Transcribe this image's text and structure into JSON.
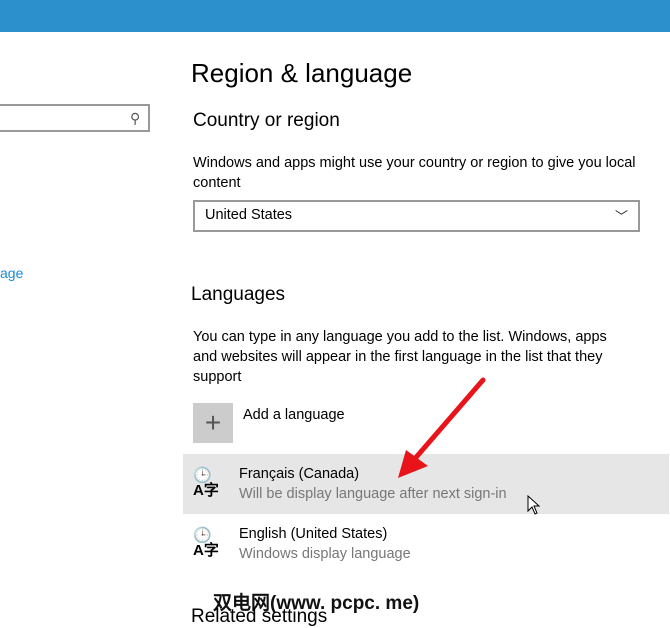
{
  "sidebar": {
    "search_placeholder": "",
    "link_fragment": "age"
  },
  "header": {
    "title": "Region & language"
  },
  "country": {
    "heading": "Country or region",
    "description": "Windows and apps might use your country or region to give you local content",
    "selected": "United States"
  },
  "languages": {
    "heading": "Languages",
    "description": "You can type in any language you add to the list. Windows, apps and websites will appear in the first language in the list that they support",
    "add_label": "Add a language",
    "items": [
      {
        "name": "Français (Canada)",
        "status": "Will be display language after next sign-in"
      },
      {
        "name": "English (United States)",
        "status": "Windows display language"
      }
    ]
  },
  "related": {
    "heading": "Related settings"
  },
  "watermark": "双电网(www. pcpc. me)",
  "colors": {
    "titlebar": "#2b90cc",
    "arrow": "#e8141a",
    "selected_row": "#e6e6e6"
  }
}
